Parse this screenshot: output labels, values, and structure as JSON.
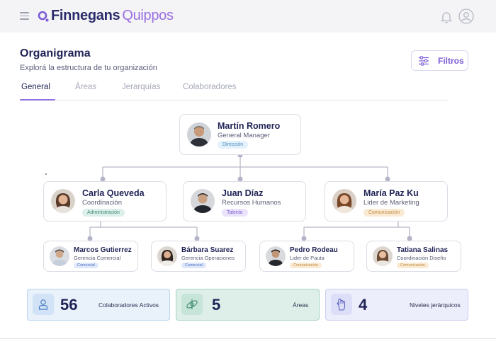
{
  "app": {
    "brand_primary": "Finnegans",
    "brand_secondary": "Quippos",
    "accent": "#8d6ee0"
  },
  "header": {
    "title": "Organigrama",
    "subtitle": "Explorá la estructura de tu organización",
    "filter_label": "Filtros"
  },
  "tabs": [
    {
      "label": "General",
      "active": true
    },
    {
      "label": "Áreas",
      "active": false
    },
    {
      "label": "Jerarquías",
      "active": false
    },
    {
      "label": "Colaboradores",
      "active": false
    }
  ],
  "org": {
    "root": {
      "name": "Martín Romero",
      "role": "General Manager",
      "tag": "Dirección",
      "tag_color": "#e2f1fb"
    },
    "level2": [
      {
        "name": "Carla Queveda",
        "role": "Coordinación",
        "tag": "Administración",
        "tag_color": "#dcefea"
      },
      {
        "name": "Juan Díaz",
        "role": "Recursos Humanos",
        "tag": "Talento",
        "tag_color": "#ebe3fb"
      },
      {
        "name": "María Paz Ku",
        "role": "Lider de Marketing",
        "tag": "Comunicación",
        "tag_color": "#fbead3"
      }
    ],
    "level3": [
      {
        "name": "Marcos Gutierrez",
        "role": "Gerencia Comercial",
        "tag": "Comercial",
        "tag_color": "#dfe8fb"
      },
      {
        "name": "Bárbara Suarez",
        "role": "Gerencia Operaciones",
        "tag": "Comercial",
        "tag_color": "#dfe8fb"
      },
      {
        "name": "Pedro Rodeau",
        "role": "Lider de Pauta",
        "tag": "Comunicación",
        "tag_color": "#fbead3"
      },
      {
        "name": "Tatiana Salinas",
        "role": "Coordinación Diseño",
        "tag": "Comunicación",
        "tag_color": "#fbead3"
      }
    ]
  },
  "stats": [
    {
      "value": "56",
      "label": "Colaboradores Activos",
      "icon": "person-icon",
      "bg": "#e9f1fb",
      "border": "#b9d3ee"
    },
    {
      "value": "5",
      "label": "Áreas",
      "icon": "network-icon",
      "bg": "#ddefe8",
      "border": "#a8d4c4"
    },
    {
      "value": "4",
      "label": "Niveles jerárquicos",
      "icon": "hand-icon",
      "bg": "#eceefb",
      "border": "#c9cdee"
    }
  ]
}
